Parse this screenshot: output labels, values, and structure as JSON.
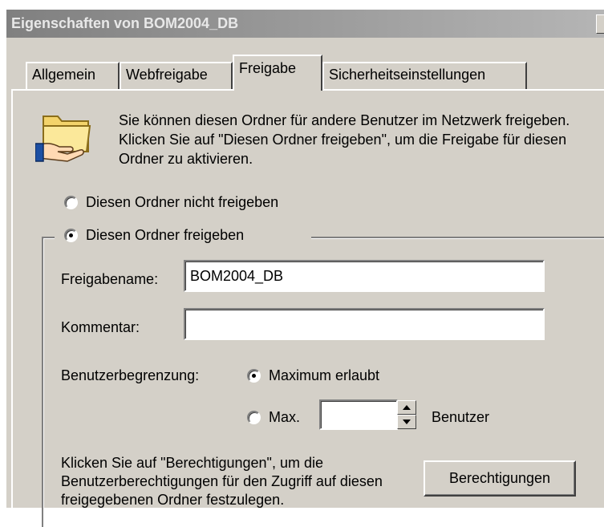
{
  "window": {
    "title": "Eigenschaften von BOM2004_DB"
  },
  "tabs": [
    {
      "label": "Allgemein",
      "active": false
    },
    {
      "label": "Webfreigabe",
      "active": false
    },
    {
      "label": "Freigabe",
      "active": true
    },
    {
      "label": "Sicherheitseinstellungen",
      "active": false
    }
  ],
  "sharing": {
    "icon": "shared-folder-icon",
    "description": "Sie können diesen Ordner für andere Benutzer im Netzwerk freigeben. Klicken Sie auf \"Diesen Ordner freigeben\", um die Freigabe für diesen Ordner zu aktivieren.",
    "option_not_shared": "Diesen Ordner nicht freigeben",
    "option_shared": "Diesen Ordner freigeben",
    "selected_option": "shared"
  },
  "form": {
    "share_name_label": "Freigabename:",
    "share_name_value": "BOM2004_DB",
    "comment_label": "Kommentar:",
    "comment_value": "",
    "user_limit_label": "Benutzerbegrenzung:",
    "max_allowed_label": "Maximum erlaubt",
    "max_label": "Max.",
    "max_value": "",
    "users_label": "Benutzer",
    "selected_limit": "maximum"
  },
  "permissions": {
    "info_text": "Klicken Sie auf \"Berechtigungen\", um die Benutzerberechtigungen für den Zugriff auf diesen freigegebenen Ordner festzulegen.",
    "button_label": "Berechtigungen"
  }
}
